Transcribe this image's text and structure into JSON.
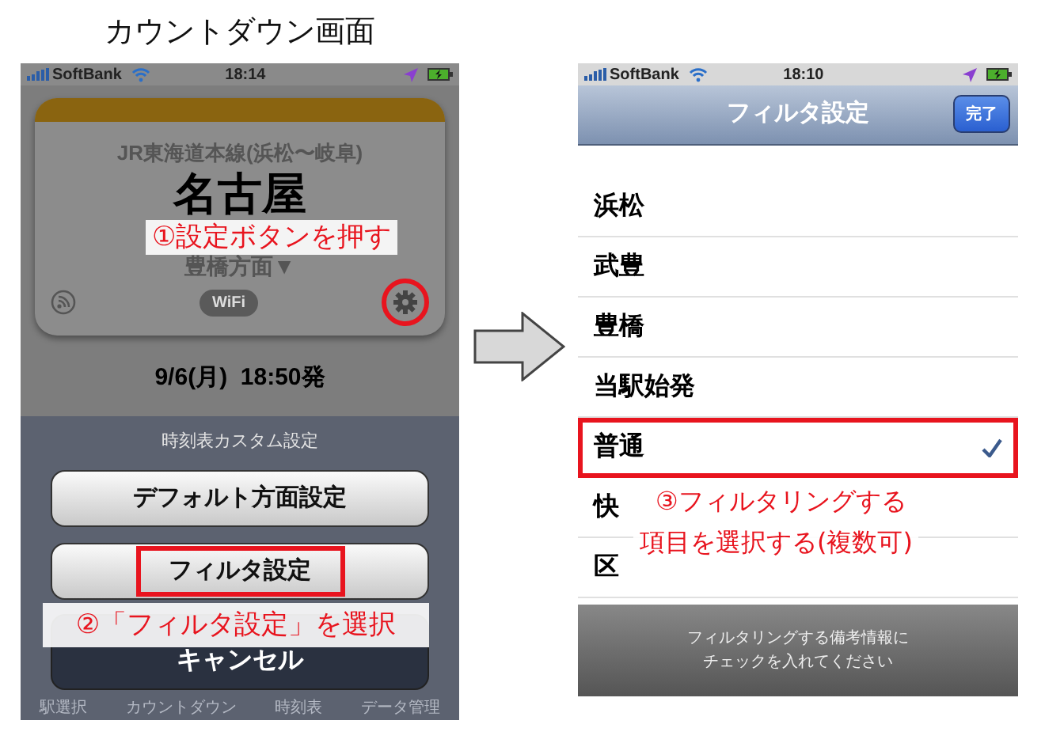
{
  "caption": "カウントダウン画面",
  "countdown_screen": {
    "status_bar": {
      "carrier": "SoftBank",
      "time": "18:14"
    },
    "line": "JR東海道本線(浜松〜岐阜)",
    "station": "名古屋",
    "direction": "豊橋方面▼",
    "wifi_badge": "WiFi",
    "settings_highlighted": true,
    "departure": "9/6(月)  18:50発",
    "annotation": "①設定ボタンを押す",
    "action_sheet": {
      "title": "時刻表カスタム設定",
      "buttons": [
        {
          "label": "デフォルト方面設定",
          "kind": "default",
          "highlighted": false
        },
        {
          "label": "フィルタ設定",
          "kind": "default",
          "highlighted": true
        },
        {
          "label": "キャンセル",
          "kind": "cancel",
          "highlighted": false
        }
      ],
      "annotation": "②「フィルタ設定」を選択"
    },
    "tab_bar": [
      "駅選択",
      "カウントダウン",
      "時刻表",
      "データ管理"
    ]
  },
  "filter_screen": {
    "status_bar": {
      "carrier": "SoftBank",
      "time": "18:10"
    },
    "title": "フィルタ設定",
    "done_button": "完了",
    "items": [
      {
        "label": "浜松",
        "checked": false,
        "highlighted": false
      },
      {
        "label": "武豊",
        "checked": false,
        "highlighted": false
      },
      {
        "label": "豊橋",
        "checked": false,
        "highlighted": false
      },
      {
        "label": "当駅始発",
        "checked": false,
        "highlighted": false
      },
      {
        "label": "普通",
        "checked": true,
        "highlighted": true
      },
      {
        "label": "快",
        "checked": false,
        "highlighted": false
      },
      {
        "label": "区",
        "checked": false,
        "highlighted": false
      }
    ],
    "annotation": [
      "③フィルタリングする",
      "項目を選択する(複数可)"
    ],
    "footer": [
      "フィルタリングする備考情報に",
      "チェックを入れてください"
    ]
  }
}
